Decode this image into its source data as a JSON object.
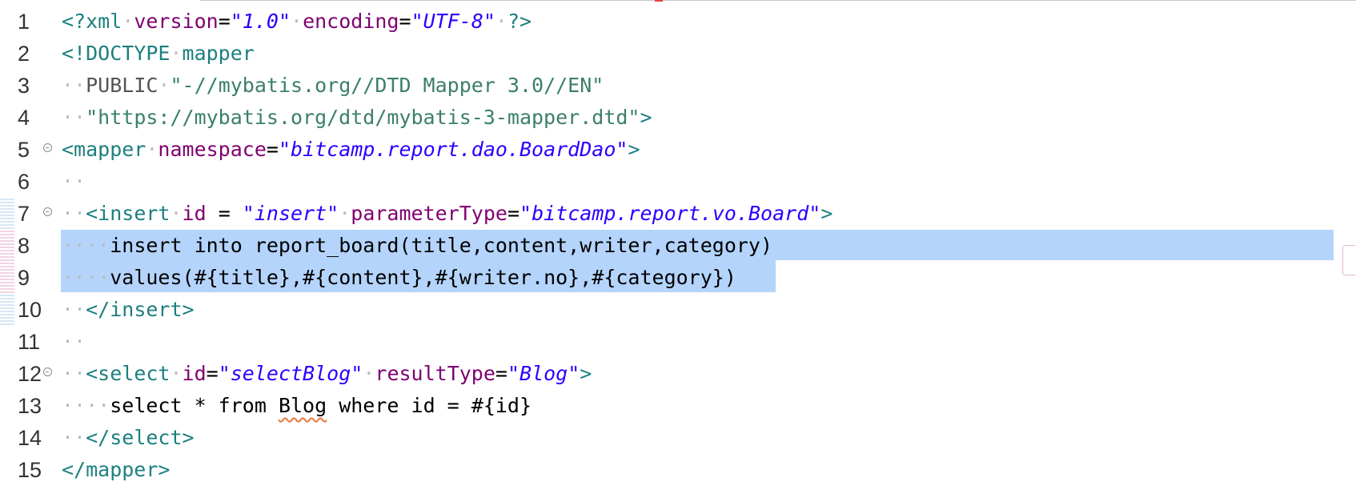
{
  "editor": {
    "lines": [
      {
        "no": "1"
      },
      {
        "no": "2"
      },
      {
        "no": "3"
      },
      {
        "no": "4"
      },
      {
        "no": "5"
      },
      {
        "no": "6"
      },
      {
        "no": "7"
      },
      {
        "no": "8"
      },
      {
        "no": "9"
      },
      {
        "no": "10"
      },
      {
        "no": "11"
      },
      {
        "no": "12"
      },
      {
        "no": "13"
      },
      {
        "no": "14"
      },
      {
        "no": "15"
      }
    ]
  },
  "code": {
    "l1": {
      "open": "<?xml",
      "attr1": "version",
      "eq1": "=",
      "val1": "\"1.0\"",
      "attr2": "encoding",
      "eq2": "=",
      "val2": "\"UTF-8\"",
      "close": "?>"
    },
    "l2": {
      "open": "<!DOCTYPE",
      "name": "mapper"
    },
    "l3": {
      "kw": "PUBLIC",
      "str": "\"-//mybatis.org//DTD Mapper 3.0//EN\""
    },
    "l4": {
      "str": "\"https://mybatis.org/dtd/mybatis-3-mapper.dtd\"",
      "close": ">"
    },
    "l5": {
      "open": "<mapper",
      "attr": "namespace",
      "eq": "=",
      "val": "\"bitcamp.report.dao.BoardDao\"",
      "close": ">"
    },
    "l7": {
      "open": "<insert",
      "attr1": "id",
      "eq1": " = ",
      "val1": "\"insert\"",
      "attr2": "parameterType",
      "eq2": "=",
      "val2": "\"bitcamp.report.vo.Board\"",
      "close": ">"
    },
    "l8": {
      "text": "insert into report_board(title,content,writer,category)"
    },
    "l9": {
      "text": "values(#{title},#{content},#{writer.no},#{category})"
    },
    "l10": {
      "close": "</insert>"
    },
    "l12": {
      "open": "<select",
      "attr1": "id",
      "eq1": "=",
      "val1": "\"selectBlog\"",
      "attr2": "resultType",
      "eq2": "=",
      "val2": "\"Blog\"",
      "close": ">"
    },
    "l13": {
      "t1": "select * from ",
      "t2": "Blog",
      "t3": " where id = #{id}"
    },
    "l14": {
      "close": "</select>"
    },
    "l15": {
      "close": "</mapper>"
    }
  },
  "colors": {
    "selection": "#b4d4fb",
    "tag": "#1d7f7f",
    "attribute": "#7f0071",
    "string": "#2a00ff"
  }
}
